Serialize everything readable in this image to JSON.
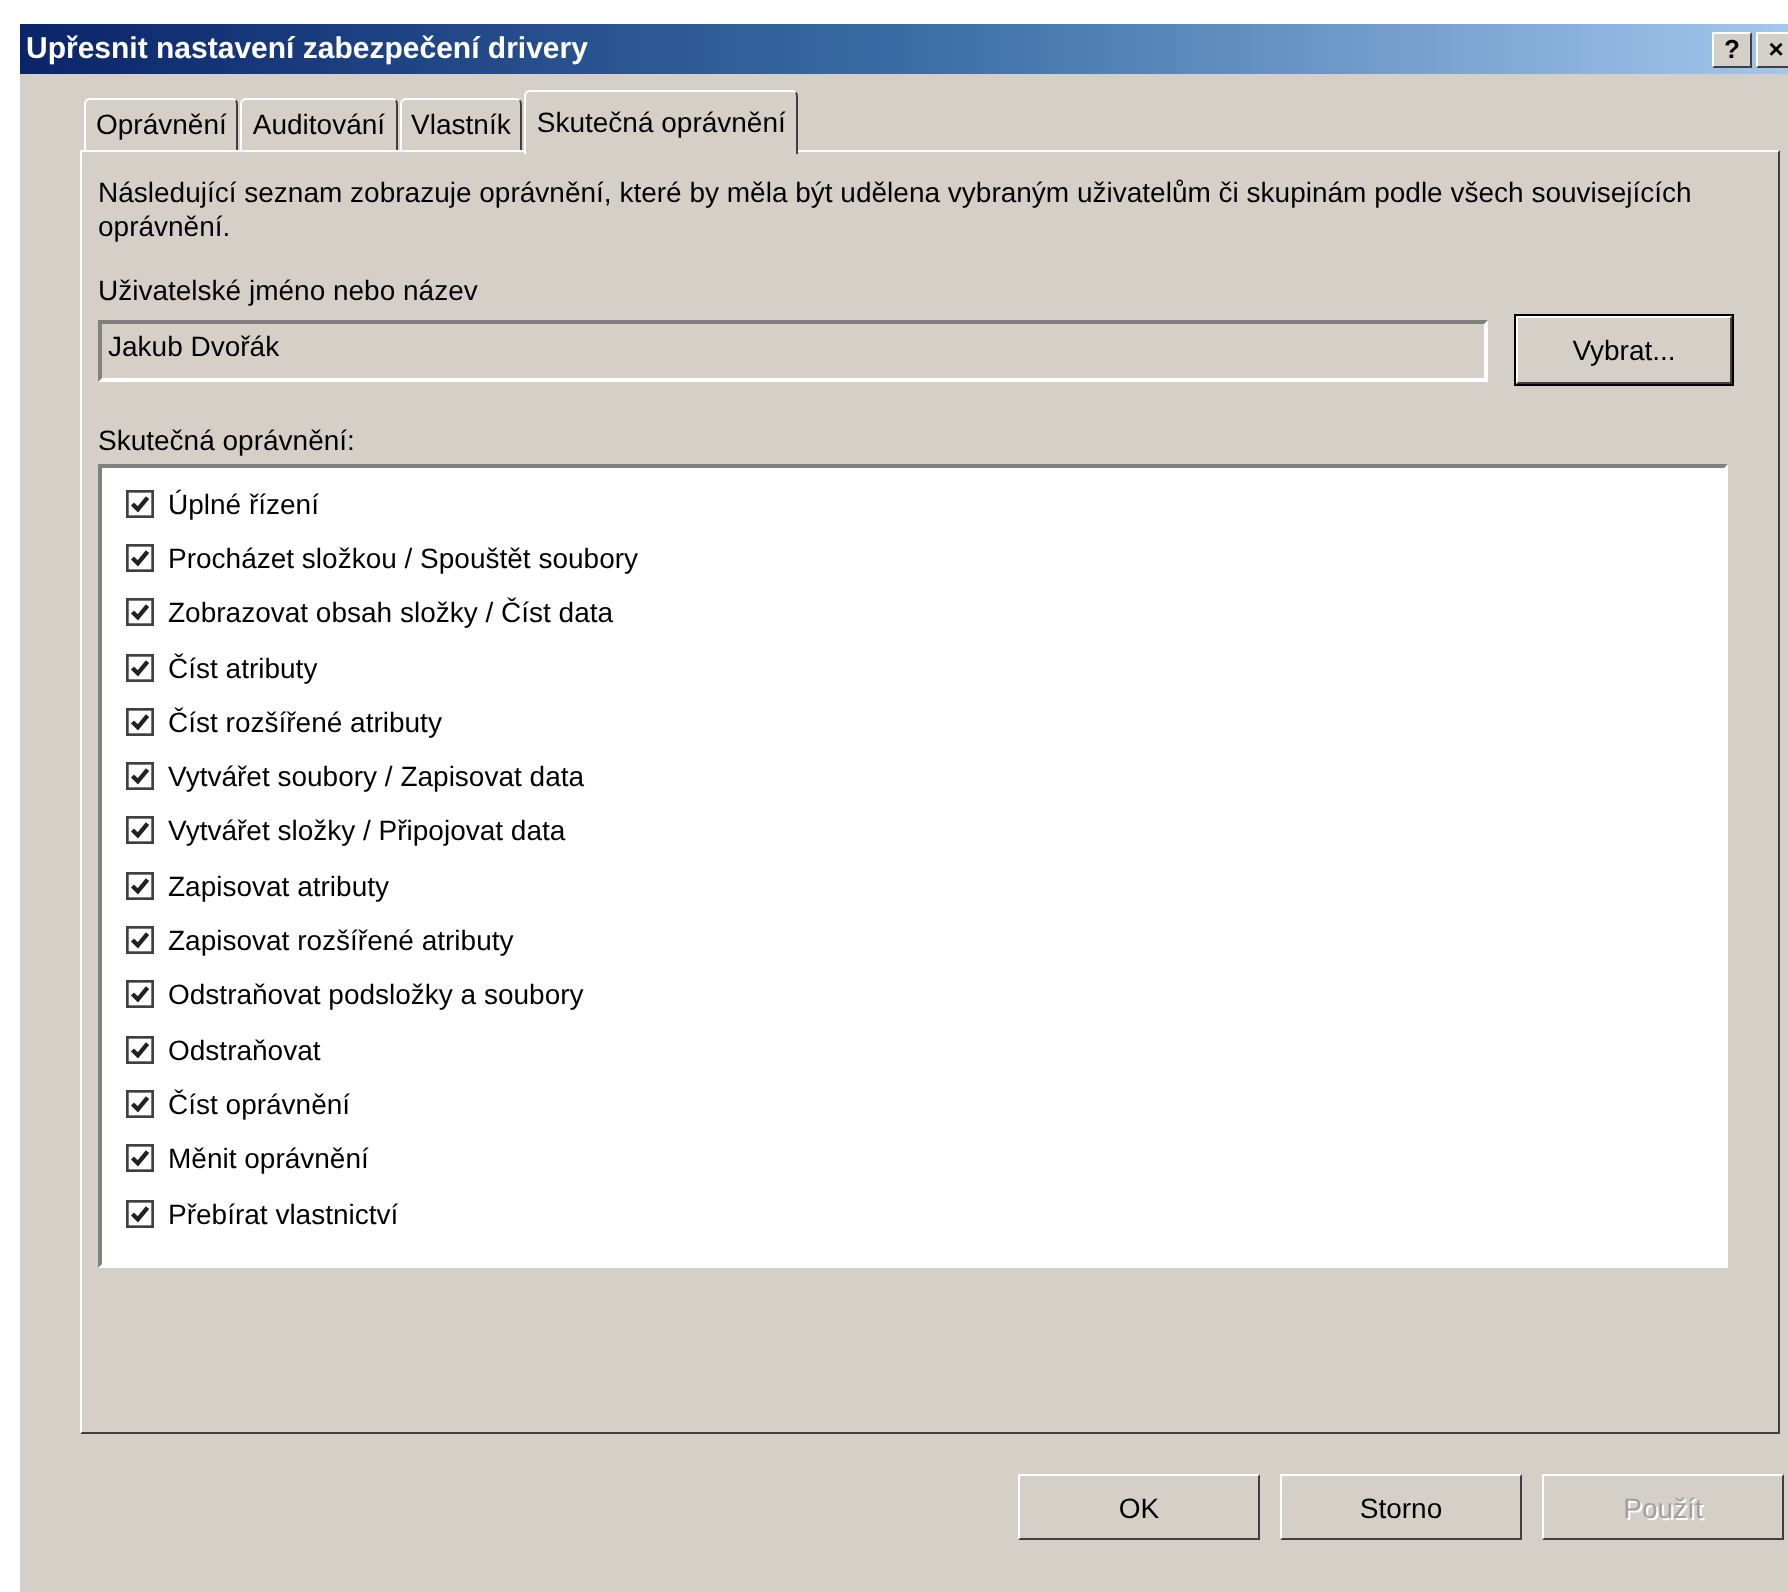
{
  "window": {
    "title": "Upřesnit nastavení zabezpečení drivery",
    "help_button": "?",
    "close_button": "×"
  },
  "tabs": [
    {
      "label": "Oprávnění",
      "selected": false
    },
    {
      "label": "Auditování",
      "selected": false
    },
    {
      "label": "Vlastník",
      "selected": false
    },
    {
      "label": "Skutečná oprávnění",
      "selected": true
    }
  ],
  "description": "Následující seznam zobrazuje oprávnění, které by měla být udělena vybraným uživatelům či skupinám podle všech souvisejících oprávnění.",
  "user_field": {
    "label": "Uživatelské jméno nebo název",
    "value": "Jakub Dvořák",
    "button": "Vybrat..."
  },
  "permissions_label": "Skutečná oprávnění:",
  "permissions": [
    {
      "label": "Úplné řízení",
      "checked": true
    },
    {
      "label": "Procházet složkou / Spouštět soubory",
      "checked": true
    },
    {
      "label": "Zobrazovat obsah složky / Číst data",
      "checked": true
    },
    {
      "label": "Číst atributy",
      "checked": true
    },
    {
      "label": "Číst rozšířené atributy",
      "checked": true
    },
    {
      "label": "Vytvářet soubory / Zapisovat data",
      "checked": true
    },
    {
      "label": "Vytvářet složky / Připojovat data",
      "checked": true
    },
    {
      "label": "Zapisovat atributy",
      "checked": true
    },
    {
      "label": "Zapisovat rozšířené atributy",
      "checked": true
    },
    {
      "label": "Odstraňovat podsložky a soubory",
      "checked": true
    },
    {
      "label": "Odstraňovat",
      "checked": true
    },
    {
      "label": "Číst oprávnění",
      "checked": true
    },
    {
      "label": "Měnit oprávnění",
      "checked": true
    },
    {
      "label": "Přebírat vlastnictví",
      "checked": true
    }
  ],
  "buttons": [
    {
      "label": "OK",
      "disabled": false
    },
    {
      "label": "Storno",
      "disabled": false
    },
    {
      "label": "Použít",
      "disabled": true
    }
  ]
}
